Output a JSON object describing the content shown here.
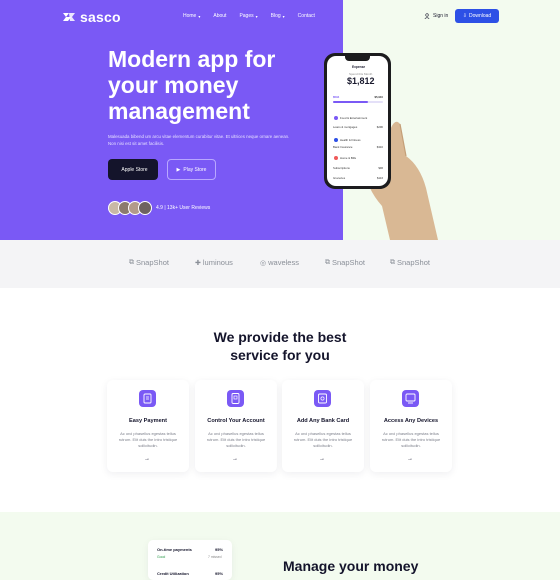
{
  "nav": {
    "logo": "sasco",
    "menu": [
      {
        "label": "Home",
        "dropdown": true
      },
      {
        "label": "About",
        "dropdown": false
      },
      {
        "label": "Pages",
        "dropdown": true
      },
      {
        "label": "Blog",
        "dropdown": true
      },
      {
        "label": "Contact",
        "dropdown": false
      }
    ],
    "signin": "Sign in",
    "download": "Download"
  },
  "hero": {
    "title_line1": "Modern app for",
    "title_line2": "your money",
    "title_line3": "management",
    "description": "Malesuada bibend um arcu vitae elementum curabitur vitae. Et ultrices neque ornare aenean. Non nisi est sit amet facilisis.",
    "apple_button": "Apple Store",
    "play_button": "Play Store",
    "rating": "4.9 | 13k+ User Reviews"
  },
  "phone": {
    "title": "Expense",
    "balance_label": "Spend this Month",
    "balance": "$1,812",
    "col_left_label": "$594",
    "col_right_label": "$5,910",
    "rows": [
      {
        "left": "Food & Entertainment",
        "right": ""
      },
      {
        "left": "Loans & mortgages",
        "right": "$296"
      },
      {
        "left": "Health & Fitness",
        "right": ""
      },
      {
        "left": "Bank Insurance",
        "right": "$316"
      },
      {
        "left": "Home & Bills",
        "right": ""
      },
      {
        "left": "Subscriptions",
        "right": "$96"
      },
      {
        "left": "Groceries",
        "right": "$116"
      }
    ]
  },
  "brands": [
    "SnapShot",
    "luminous",
    "waveless",
    "SnapShot",
    "SnapShot"
  ],
  "services": {
    "title_line1": "We provide the best",
    "title_line2": "service for you",
    "cards": [
      {
        "title": "Easy Payment",
        "desc": "Ac orci phasellus egestas tellus rutrum. Elit duis the intro tristique sollicitudin.",
        "arrow": "→"
      },
      {
        "title": "Control Your Account",
        "desc": "Ac orci phasellus egestas tellus rutrum. Elit duis the intro tristique sollicitudin.",
        "arrow": "→"
      },
      {
        "title": "Add Any Bank Card",
        "desc": "Ac orci phasellus egestas tellus rutrum. Elit duis the intro tristique sollicitudin.",
        "arrow": "→"
      },
      {
        "title": "Access Any Devices",
        "desc": "Ac orci phasellus egestas tellus rutrum. Elit duis the intro tristique sollicitudin.",
        "arrow": "→"
      }
    ]
  },
  "bottom": {
    "stat1_label": "On-time payments",
    "stat1_value": "95%",
    "stat1_sub": "Good",
    "stat1_sub2": "7 missed",
    "stat2_label": "Credit Utilization",
    "stat2_value": "95%",
    "title": "Manage your money"
  },
  "colors": {
    "accent": "#7a59f5",
    "download": "#2d50e6",
    "dark": "#14142b"
  }
}
